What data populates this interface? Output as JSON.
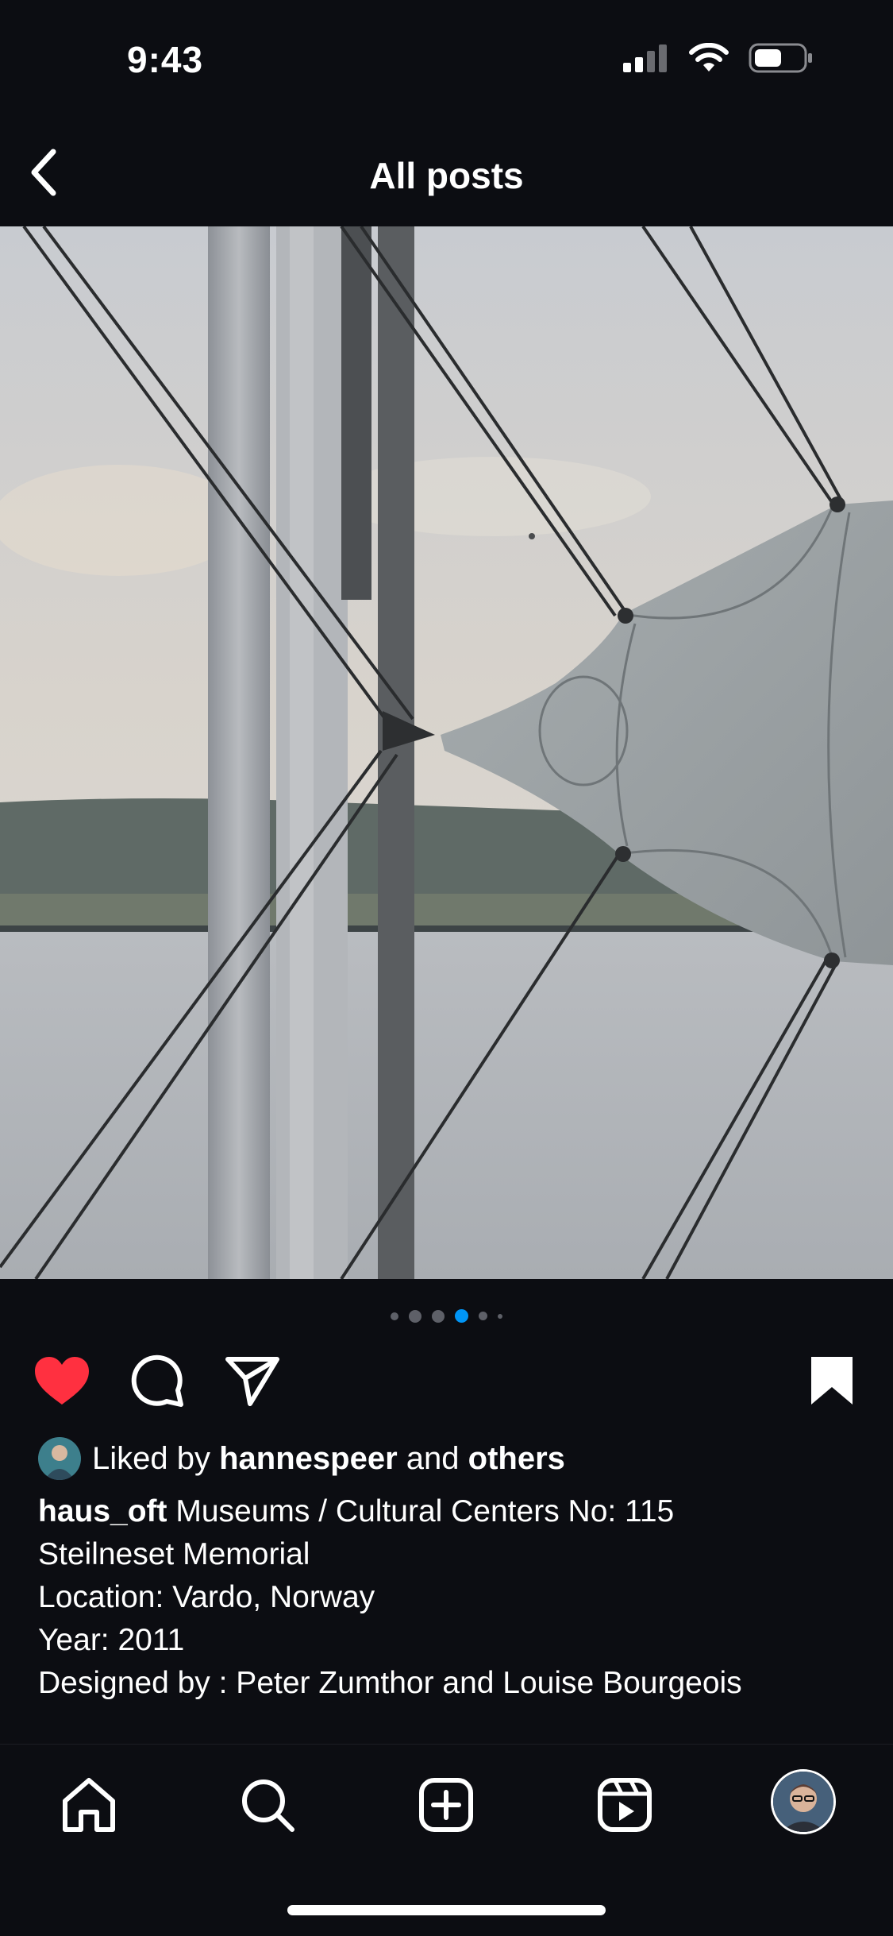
{
  "status_bar": {
    "time": "9:43"
  },
  "header": {
    "title": "All posts"
  },
  "carousel": {
    "total": 6,
    "active_index": 3
  },
  "actions": {
    "liked": true,
    "saved": true
  },
  "likes": {
    "prefix": "Liked by",
    "user": "hannespeer",
    "connector": "and",
    "others": "others"
  },
  "caption": {
    "username": "haus_oft",
    "first_line": "Museums / Cultural Centers No: 115",
    "lines": [
      "Steilneset Memorial",
      "Location: Vardo, Norway",
      "Year: 2011",
      "Designed by : Peter Zumthor and Louise Bourgeois"
    ]
  },
  "tab_bar": {
    "items": [
      "home-icon",
      "search-icon",
      "create-icon",
      "reels-icon",
      "profile-avatar"
    ]
  },
  "colors": {
    "background": "#0c0d12",
    "like": "#ff3040",
    "active_dot": "#0095f6"
  }
}
